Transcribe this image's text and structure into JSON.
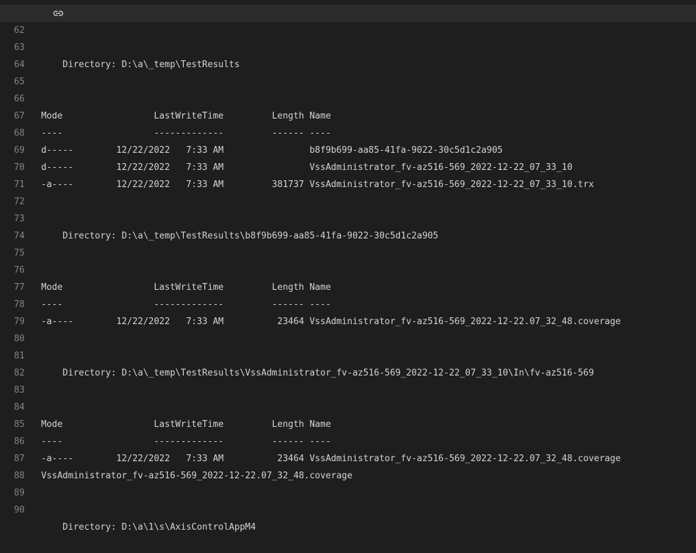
{
  "log": {
    "link_icon": "link-icon",
    "lines": [
      {
        "num": "62",
        "text": ""
      },
      {
        "num": "63",
        "text": "    Directory: D:\\a\\_temp\\TestResults"
      },
      {
        "num": "64",
        "text": ""
      },
      {
        "num": "65",
        "text": ""
      },
      {
        "num": "66",
        "text": "Mode                 LastWriteTime         Length Name"
      },
      {
        "num": "67",
        "text": "----                 -------------         ------ ----"
      },
      {
        "num": "68",
        "text": "d-----        12/22/2022   7:33 AM                b8f9b699-aa85-41fa-9022-30c5d1c2a905"
      },
      {
        "num": "69",
        "text": "d-----        12/22/2022   7:33 AM                VssAdministrator_fv-az516-569_2022-12-22_07_33_10"
      },
      {
        "num": "70",
        "text": "-a----        12/22/2022   7:33 AM         381737 VssAdministrator_fv-az516-569_2022-12-22_07_33_10.trx"
      },
      {
        "num": "71",
        "text": ""
      },
      {
        "num": "72",
        "text": ""
      },
      {
        "num": "73",
        "text": "    Directory: D:\\a\\_temp\\TestResults\\b8f9b699-aa85-41fa-9022-30c5d1c2a905"
      },
      {
        "num": "74",
        "text": ""
      },
      {
        "num": "75",
        "text": ""
      },
      {
        "num": "76",
        "text": "Mode                 LastWriteTime         Length Name"
      },
      {
        "num": "77",
        "text": "----                 -------------         ------ ----"
      },
      {
        "num": "78",
        "text": "-a----        12/22/2022   7:33 AM          23464 VssAdministrator_fv-az516-569_2022-12-22.07_32_48.coverage"
      },
      {
        "num": "79",
        "text": ""
      },
      {
        "num": "80",
        "text": ""
      },
      {
        "num": "81",
        "text": "    Directory: D:\\a\\_temp\\TestResults\\VssAdministrator_fv-az516-569_2022-12-22_07_33_10\\In\\fv-az516-569"
      },
      {
        "num": "82",
        "text": ""
      },
      {
        "num": "83",
        "text": ""
      },
      {
        "num": "84",
        "text": "Mode                 LastWriteTime         Length Name"
      },
      {
        "num": "85",
        "text": "----                 -------------         ------ ----"
      },
      {
        "num": "86",
        "text": "-a----        12/22/2022   7:33 AM          23464 VssAdministrator_fv-az516-569_2022-12-22.07_32_48.coverage"
      },
      {
        "num": "87",
        "text": "VssAdministrator_fv-az516-569_2022-12-22.07_32_48.coverage"
      },
      {
        "num": "88",
        "text": ""
      },
      {
        "num": "89",
        "text": ""
      },
      {
        "num": "90",
        "text": "    Directory: D:\\a\\1\\s\\AxisControlAppM4"
      }
    ]
  }
}
